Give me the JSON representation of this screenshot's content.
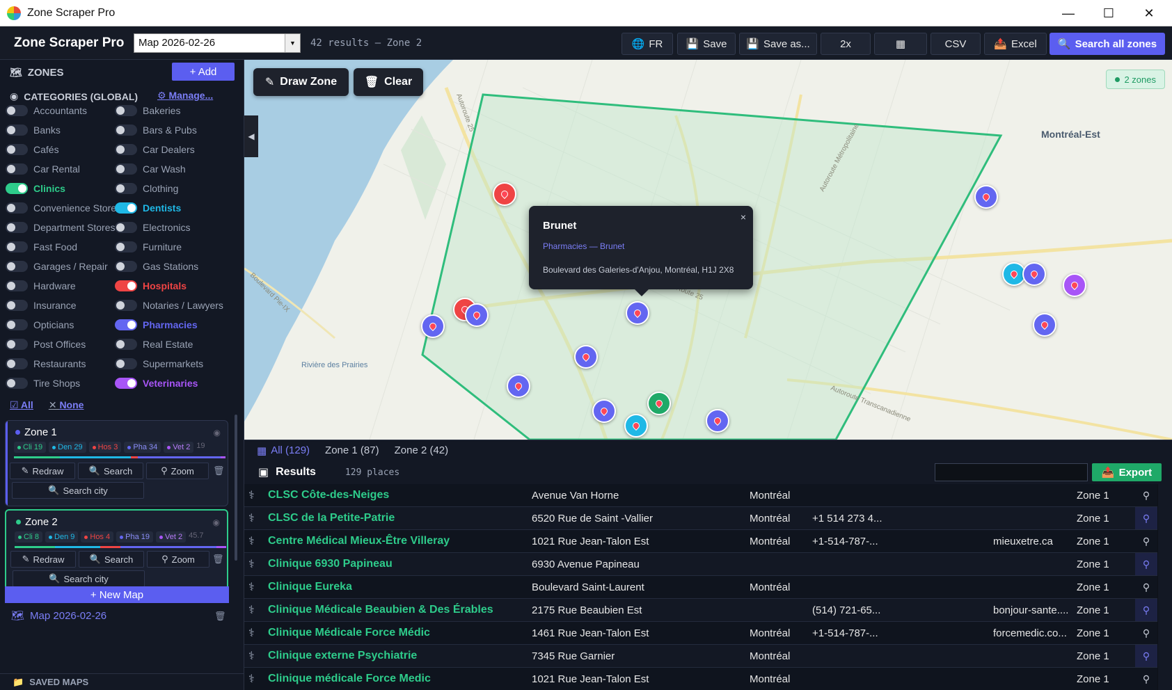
{
  "window": {
    "title": "Zone Scraper Pro"
  },
  "toolbar": {
    "brand": "Zone Scraper Pro",
    "map_select": "Map 2026-02-26",
    "results_info": "42 results — Zone 2",
    "buttons": {
      "lang": "FR",
      "save": "Save",
      "save_as": "Save as...",
      "speed": "2x",
      "csv": "CSV",
      "excel": "Excel",
      "search_all": "Search all zones"
    }
  },
  "sidebar": {
    "zones_title": "ZONES",
    "add_label": "+ Add",
    "categories_title": "CATEGORIES (GLOBAL)",
    "manage_label": "Manage...",
    "categories": [
      {
        "label": "Accountants",
        "on": false,
        "color": ""
      },
      {
        "label": "Bakeries",
        "on": false,
        "color": ""
      },
      {
        "label": "Banks",
        "on": false,
        "color": ""
      },
      {
        "label": "Bars & Pubs",
        "on": false,
        "color": ""
      },
      {
        "label": "Cafés",
        "on": false,
        "color": ""
      },
      {
        "label": "Car Dealers",
        "on": false,
        "color": ""
      },
      {
        "label": "Car Rental",
        "on": false,
        "color": ""
      },
      {
        "label": "Car Wash",
        "on": false,
        "color": ""
      },
      {
        "label": "Clinics",
        "on": true,
        "color": "#2ecc8b"
      },
      {
        "label": "Clothing",
        "on": false,
        "color": ""
      },
      {
        "label": "Convenience Store",
        "on": false,
        "color": ""
      },
      {
        "label": "Dentists",
        "on": true,
        "color": "#1fb8e6"
      },
      {
        "label": "Department Stores",
        "on": false,
        "color": ""
      },
      {
        "label": "Electronics",
        "on": false,
        "color": ""
      },
      {
        "label": "Fast Food",
        "on": false,
        "color": ""
      },
      {
        "label": "Furniture",
        "on": false,
        "color": ""
      },
      {
        "label": "Garages / Repair",
        "on": false,
        "color": ""
      },
      {
        "label": "Gas Stations",
        "on": false,
        "color": ""
      },
      {
        "label": "Hardware",
        "on": false,
        "color": ""
      },
      {
        "label": "Hospitals",
        "on": true,
        "color": "#ef4444"
      },
      {
        "label": "Insurance",
        "on": false,
        "color": ""
      },
      {
        "label": "Notaries / Lawyers",
        "on": false,
        "color": ""
      },
      {
        "label": "Opticians",
        "on": false,
        "color": ""
      },
      {
        "label": "Pharmacies",
        "on": true,
        "color": "#6366f1"
      },
      {
        "label": "Post Offices",
        "on": false,
        "color": ""
      },
      {
        "label": "Real Estate",
        "on": false,
        "color": ""
      },
      {
        "label": "Restaurants",
        "on": false,
        "color": ""
      },
      {
        "label": "Supermarkets",
        "on": false,
        "color": ""
      },
      {
        "label": "Tire Shops",
        "on": false,
        "color": ""
      },
      {
        "label": "Veterinaries",
        "on": true,
        "color": "#a855f7"
      }
    ],
    "all_label": "All",
    "none_label": "None",
    "zones": [
      {
        "name": "Zone 1",
        "chips": [
          {
            "label": "Cli 19",
            "color": "#2ecc8b"
          },
          {
            "label": "Den 29",
            "color": "#1fb8e6"
          },
          {
            "label": "Hos 3",
            "color": "#ef4444"
          },
          {
            "label": "Pha 34",
            "color": "#6366f1"
          },
          {
            "label": "Vet 2",
            "color": "#a855f7"
          }
        ],
        "extra": "19",
        "redraw": "Redraw",
        "search": "Search",
        "zoom": "Zoom",
        "search_city": "Search city"
      },
      {
        "name": "Zone 2",
        "chips": [
          {
            "label": "Cli 8",
            "color": "#2ecc8b"
          },
          {
            "label": "Den 9",
            "color": "#1fb8e6"
          },
          {
            "label": "Hos 4",
            "color": "#ef4444"
          },
          {
            "label": "Pha 19",
            "color": "#6366f1"
          },
          {
            "label": "Vet 2",
            "color": "#a855f7"
          }
        ],
        "extra": "45.7",
        "redraw": "Redraw",
        "search": "Search",
        "zoom": "Zoom",
        "search_city": "Search city"
      }
    ],
    "new_map": "+ New Map",
    "map_item": "Map 2026-02-26",
    "saved_maps": "SAVED MAPS"
  },
  "map": {
    "draw_zone": "Draw Zone",
    "clear": "Clear",
    "zones_badge": "2 zones",
    "labels": {
      "montreal_est": "Montréal-Est",
      "riviere": "Rivière des Prairies",
      "autoroute25": "Autoroute 25",
      "autoroute_metro": "Autoroute Métropolitaine",
      "autoroute_trans": "Autoroute Transcanadienne",
      "bd_pie": "Boulevard Pie-IX",
      "route25": "Route 25"
    },
    "popup": {
      "title": "Brunet",
      "category": "Pharmacies — Brunet",
      "address": "Boulevard des Galeries-d'Anjou, Montréal, H1J 2X8",
      "close": "×"
    }
  },
  "tabs": {
    "all": "All (129)",
    "zone1": "Zone 1 (87)",
    "zone2": "Zone 2 (42)"
  },
  "results": {
    "title": "Results",
    "count": "129 places",
    "export": "Export",
    "rows": [
      {
        "name": "CLSC Côte-des-Neiges",
        "address": "Avenue Van Horne",
        "city": "Montréal",
        "phone": "",
        "web": "",
        "zone": "Zone 1",
        "hl": false
      },
      {
        "name": "CLSC de la Petite-Patrie",
        "address": "6520 Rue de Saint -Vallier",
        "city": "Montréal",
        "phone": "+1 514 273 4...",
        "web": "",
        "zone": "Zone 1",
        "hl": true
      },
      {
        "name": "Centre Médical Mieux-Être Villeray",
        "address": "1021 Rue Jean-Talon Est",
        "city": "Montréal",
        "phone": "+1-514-787-...",
        "web": "mieuxetre.ca",
        "zone": "Zone 1",
        "hl": false
      },
      {
        "name": "Clinique 6930 Papineau",
        "address": "6930 Avenue Papineau",
        "city": "",
        "phone": "",
        "web": "",
        "zone": "Zone 1",
        "hl": true
      },
      {
        "name": "Clinique Eureka",
        "address": "Boulevard Saint-Laurent",
        "city": "Montréal",
        "phone": "",
        "web": "",
        "zone": "Zone 1",
        "hl": false
      },
      {
        "name": "Clinique Médicale Beaubien & Des Érables",
        "address": "2175 Rue Beaubien Est",
        "city": "",
        "phone": "(514) 721-65...",
        "web": "bonjour-sante....",
        "zone": "Zone 1",
        "hl": true
      },
      {
        "name": "Clinique Médicale Force Médic",
        "address": "1461 Rue Jean-Talon Est",
        "city": "Montréal",
        "phone": "+1-514-787-...",
        "web": "forcemedic.co...",
        "zone": "Zone 1",
        "hl": false
      },
      {
        "name": "Clinique externe Psychiatrie",
        "address": "7345 Rue Garnier",
        "city": "Montréal",
        "phone": "",
        "web": "",
        "zone": "Zone 1",
        "hl": true
      },
      {
        "name": "Clinique médicale Force Medic",
        "address": "1021 Rue Jean-Talon Est",
        "city": "Montréal",
        "phone": "",
        "web": "",
        "zone": "Zone 1",
        "hl": false
      }
    ]
  }
}
